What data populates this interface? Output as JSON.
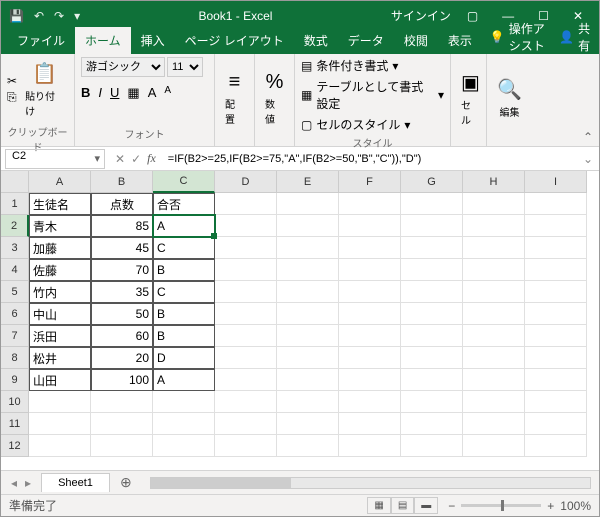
{
  "title": "Book1 - Excel",
  "signin": "サインイン",
  "tabs": {
    "file": "ファイル",
    "home": "ホーム",
    "insert": "挿入",
    "layout": "ページ レイアウト",
    "formulas": "数式",
    "data": "データ",
    "review": "校閲",
    "view": "表示",
    "tell": "操作アシスト",
    "share": "共有"
  },
  "ribbon": {
    "clipboard": {
      "paste": "貼り付け",
      "label": "クリップボード"
    },
    "font": {
      "name": "游ゴシック",
      "size": "11",
      "label": "フォント"
    },
    "align": {
      "btn": "配置"
    },
    "number": {
      "btn": "数値"
    },
    "styles": {
      "cond": "条件付き書式",
      "table": "テーブルとして書式設定",
      "cell": "セルのスタイル",
      "label": "スタイル"
    },
    "cells": {
      "btn": "セル"
    },
    "editing": {
      "btn": "編集"
    }
  },
  "cellref": "C2",
  "formula": "=IF(B2>=25,IF(B2>=75,\"A\",IF(B2>=50,\"B\",\"C\")),\"D\")",
  "cols": [
    "A",
    "B",
    "C",
    "D",
    "E",
    "F",
    "G",
    "H",
    "I"
  ],
  "rows": [
    {
      "n": "1",
      "a": "生徒名",
      "b": "点数",
      "c": "合否"
    },
    {
      "n": "2",
      "a": "青木",
      "b": "85",
      "c": "A"
    },
    {
      "n": "3",
      "a": "加藤",
      "b": "45",
      "c": "C"
    },
    {
      "n": "4",
      "a": "佐藤",
      "b": "70",
      "c": "B"
    },
    {
      "n": "5",
      "a": "竹内",
      "b": "35",
      "c": "C"
    },
    {
      "n": "6",
      "a": "中山",
      "b": "50",
      "c": "B"
    },
    {
      "n": "7",
      "a": "浜田",
      "b": "60",
      "c": "B"
    },
    {
      "n": "8",
      "a": "松井",
      "b": "20",
      "c": "D"
    },
    {
      "n": "9",
      "a": "山田",
      "b": "100",
      "c": "A"
    },
    {
      "n": "10"
    },
    {
      "n": "11"
    },
    {
      "n": "12"
    }
  ],
  "sheet": "Sheet1",
  "status": "準備完了",
  "zoom": "100%"
}
